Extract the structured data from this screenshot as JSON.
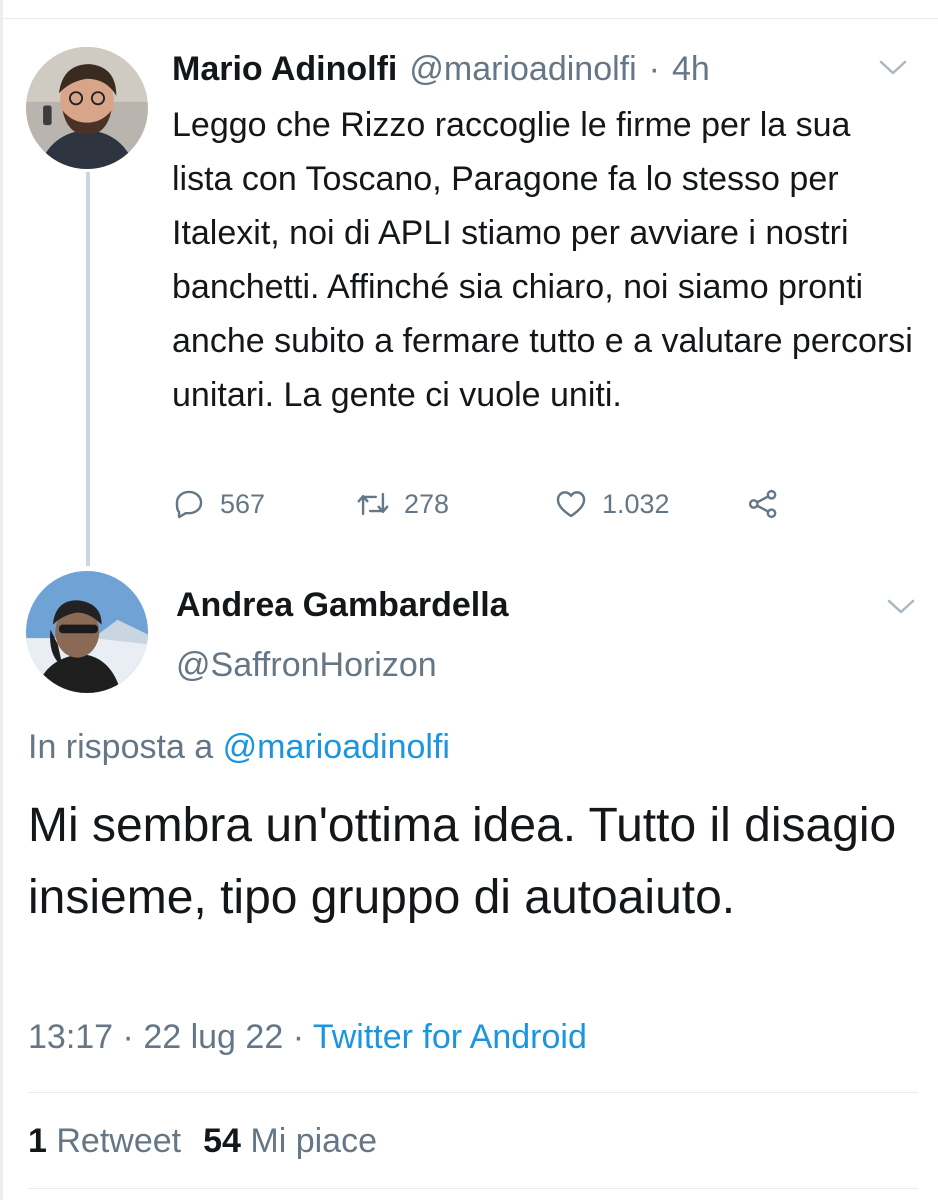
{
  "tweet1": {
    "author_name": "Mario Adinolfi",
    "author_handle": "@marioadinolfi",
    "separator": "·",
    "time": "4h",
    "text": "Leggo che Rizzo raccoglie le firme per la sua lista con Toscano, Paragone fa lo stesso per Italexit, noi di APLI stiamo per avviare i nostri banchetti. Affinché sia chiaro, noi siamo pronti anche subito a fermare tutto e a valutare percorsi unitari. La gente ci vuole uniti.",
    "reply_count": "567",
    "retweet_count": "278",
    "like_count": "1.032"
  },
  "tweet2": {
    "author_name": "Andrea Gambardella",
    "author_handle": "@SaffronHorizon",
    "reply_prefix": "In risposta a",
    "reply_mention": "@marioadinolfi",
    "text": "Mi sembra un'ottima idea. Tutto il disagio insieme, tipo gruppo di autoaiuto.",
    "time": "13:17",
    "separator": "·",
    "date": "22 lug 22",
    "source": "Twitter for Android",
    "retweets": "1",
    "retweets_label": "Retweet",
    "likes": "54",
    "likes_label": "Mi piace"
  },
  "icons": {
    "reply": "reply-icon",
    "retweet": "retweet-icon",
    "like": "heart-icon",
    "share": "share-icon",
    "menu": "chevron-down-icon"
  },
  "colors": {
    "text": "#14171a",
    "secondary": "#657786",
    "link": "#1b95e0",
    "thread_line": "#ccd6dd",
    "divider": "#e6ecf0"
  }
}
